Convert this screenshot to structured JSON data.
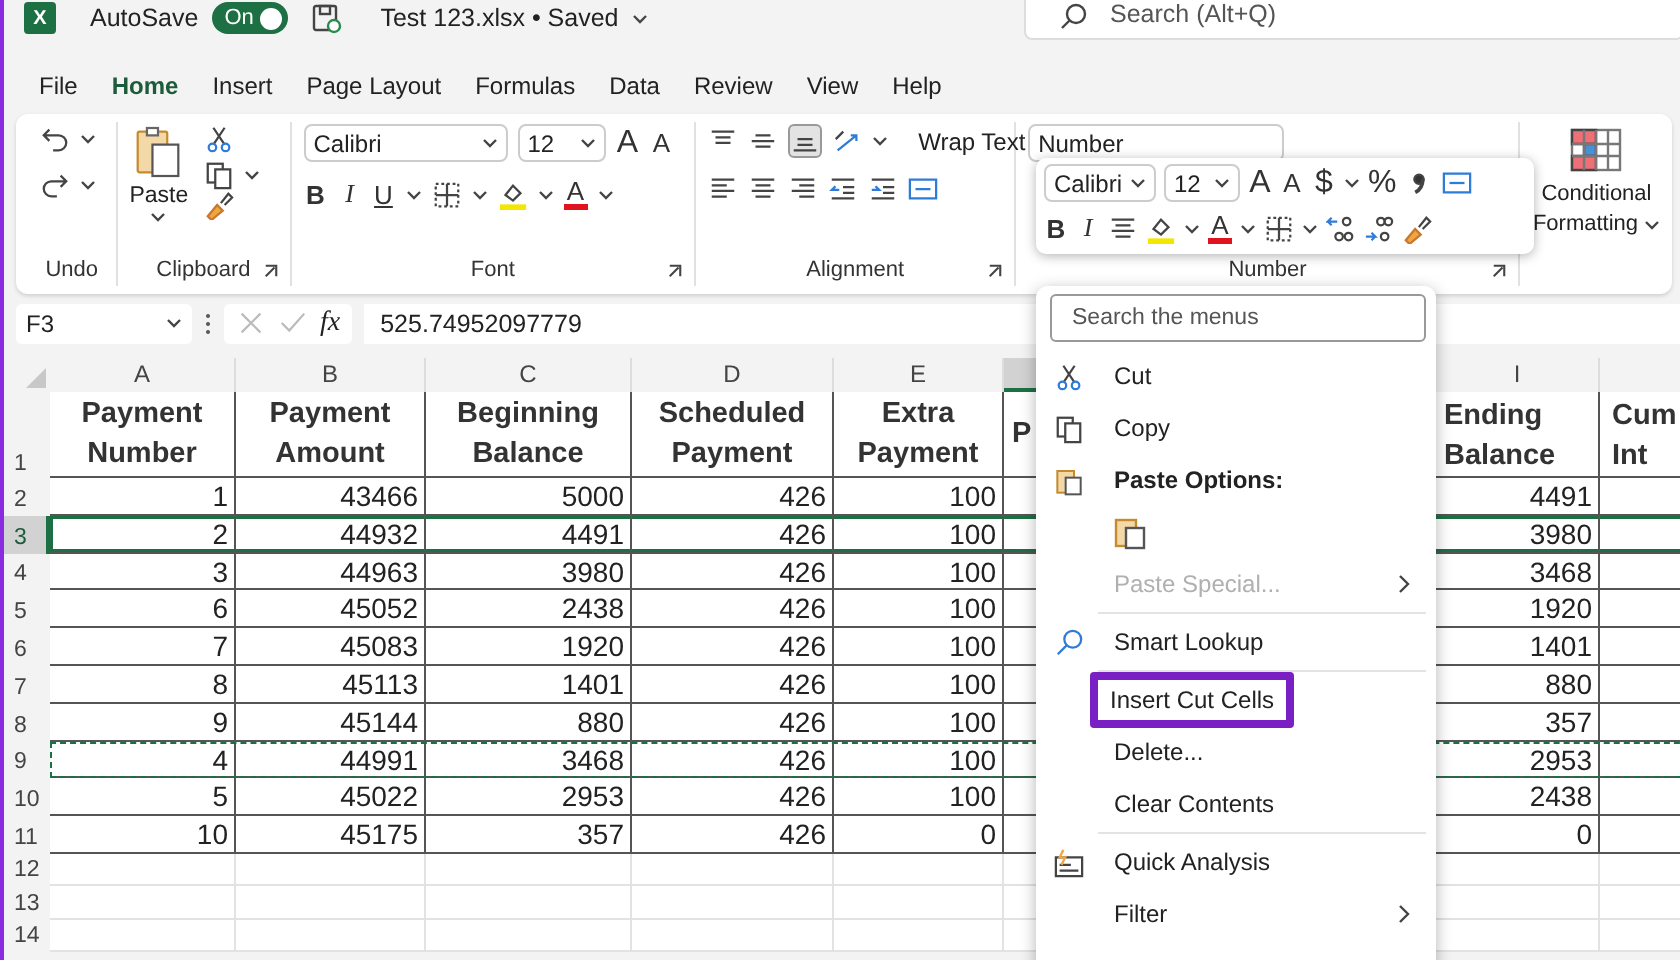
{
  "title_bar": {
    "logo_letter": "X",
    "autosave_label": "AutoSave",
    "autosave": {
      "label": "On",
      "on": true
    },
    "file_title": "Test 123.xlsx • Saved",
    "search": {
      "placeholder": "Search (Alt+Q)"
    }
  },
  "tabs": [
    {
      "label": "File",
      "selected": false
    },
    {
      "label": "Home",
      "selected": true
    },
    {
      "label": "Insert",
      "selected": false
    },
    {
      "label": "Page Layout",
      "selected": false
    },
    {
      "label": "Formulas",
      "selected": false
    },
    {
      "label": "Data",
      "selected": false
    },
    {
      "label": "Review",
      "selected": false
    },
    {
      "label": "View",
      "selected": false
    },
    {
      "label": "Help",
      "selected": false
    }
  ],
  "ribbon": {
    "undo_label": "Undo",
    "paste": "Paste",
    "clipboard_label": "Clipboard",
    "font_name": "Calibri",
    "font_size": "12",
    "grow": "A",
    "shrink": "A",
    "bold": "B",
    "italic": "I",
    "underline": "U",
    "font_color": "A",
    "font_label": "Font",
    "wrap_text": "Wrap Text",
    "alignment_label": "Alignment",
    "number_format": "Number",
    "number_label": "Number",
    "conditional": [
      "Conditional",
      "Formatting"
    ]
  },
  "mini_toolbar": {
    "font_name": "Calibri",
    "font_size": "12",
    "grow": "A",
    "shrink": "A",
    "currency": "$",
    "percent": "%",
    "bold": "B",
    "italic": "I",
    "font_color": "A"
  },
  "formula_bar": {
    "name_box": "F3",
    "fx": "fx",
    "value": "525.74952097779"
  },
  "columns": [
    {
      "letter": "A",
      "selected": false
    },
    {
      "letter": "B",
      "selected": false
    },
    {
      "letter": "C",
      "selected": false
    },
    {
      "letter": "D",
      "selected": false
    },
    {
      "letter": "E",
      "selected": false
    },
    {
      "selected": true
    },
    {
      "letter": "I",
      "selected": false
    },
    {
      "selected": false
    }
  ],
  "header_row": {
    "number": "1",
    "cells": [
      [
        "Payment",
        "Number"
      ],
      [
        "Payment",
        "Amount"
      ],
      [
        "Beginning",
        "Balance"
      ],
      [
        "Scheduled",
        "Payment"
      ],
      [
        "Extra",
        "Payment"
      ],
      [
        "P"
      ],
      [
        "Ending",
        "Balance"
      ],
      [
        "Cum",
        "Int"
      ]
    ]
  },
  "rows": [
    {
      "number": "2",
      "selected": false,
      "cut": false,
      "cells": [
        "1",
        "43466",
        "5000",
        "426",
        "100",
        null,
        "4491",
        null
      ]
    },
    {
      "number": "3",
      "selected": true,
      "cut": false,
      "cells": [
        "2",
        "44932",
        "4491",
        "426",
        "100",
        null,
        "3980",
        null
      ]
    },
    {
      "number": "4",
      "selected": false,
      "cut": false,
      "cells": [
        "3",
        "44963",
        "3980",
        "426",
        "100",
        null,
        "3468",
        null
      ]
    },
    {
      "number": "5",
      "selected": false,
      "cut": false,
      "cells": [
        "6",
        "45052",
        "2438",
        "426",
        "100",
        null,
        "1920",
        null
      ]
    },
    {
      "number": "6",
      "selected": false,
      "cut": false,
      "cells": [
        "7",
        "45083",
        "1920",
        "426",
        "100",
        null,
        "1401",
        null
      ]
    },
    {
      "number": "7",
      "selected": false,
      "cut": false,
      "cells": [
        "8",
        "45113",
        "1401",
        "426",
        "100",
        null,
        "880",
        null
      ]
    },
    {
      "number": "8",
      "selected": false,
      "cut": false,
      "cells": [
        "9",
        "45144",
        "880",
        "426",
        "100",
        null,
        "357",
        null
      ]
    },
    {
      "number": "9",
      "selected": false,
      "cut": true,
      "cells": [
        "4",
        "44991",
        "3468",
        "426",
        "100",
        null,
        "2953",
        null
      ]
    },
    {
      "number": "10",
      "selected": false,
      "cut": false,
      "cells": [
        "5",
        "45022",
        "2953",
        "426",
        "100",
        null,
        "2438",
        null
      ]
    },
    {
      "number": "11",
      "selected": false,
      "cut": false,
      "cells": [
        "10",
        "45175",
        "357",
        "426",
        "0",
        null,
        "0",
        null
      ]
    },
    {
      "number": "12",
      "selected": false,
      "cut": false
    },
    {
      "number": "13",
      "selected": false,
      "cut": false
    },
    {
      "number": "14",
      "selected": false,
      "cut": false
    }
  ],
  "context_menu": {
    "search_placeholder": "Search the menus",
    "items": [
      {
        "kind": "cut",
        "label": "Cut",
        "disabled": false,
        "submenu": false,
        "highlighted": false,
        "separator_above": false
      },
      {
        "kind": "copy",
        "label": "Copy",
        "disabled": false,
        "submenu": false,
        "highlighted": false,
        "separator_above": false
      },
      {
        "kind": "heading",
        "label": "Paste Options:",
        "disabled": false,
        "submenu": false,
        "highlighted": false,
        "separator_above": false
      },
      {
        "kind": "paste_buttons",
        "disabled": false,
        "submenu": false,
        "highlighted": false,
        "separator_above": false
      },
      {
        "kind": "plain",
        "label": "Paste Special...",
        "disabled": true,
        "submenu": true,
        "highlighted": false,
        "separator_above": false
      },
      {
        "kind": "lookup",
        "label": "Smart Lookup",
        "disabled": false,
        "submenu": false,
        "highlighted": false,
        "separator_above": true
      },
      {
        "kind": "plain",
        "label": "Insert Cut Cells",
        "disabled": false,
        "submenu": false,
        "highlighted": true,
        "separator_above": true
      },
      {
        "kind": "plain",
        "label": "Delete...",
        "disabled": false,
        "submenu": false,
        "highlighted": false,
        "separator_above": false
      },
      {
        "kind": "plain",
        "label": "Clear Contents",
        "disabled": false,
        "submenu": false,
        "highlighted": false,
        "separator_above": false
      },
      {
        "kind": "analysis",
        "label": "Quick Analysis",
        "disabled": false,
        "submenu": false,
        "highlighted": false,
        "separator_above": true
      },
      {
        "kind": "plain",
        "label": "Filter",
        "disabled": false,
        "submenu": true,
        "highlighted": false,
        "separator_above": false
      }
    ]
  }
}
